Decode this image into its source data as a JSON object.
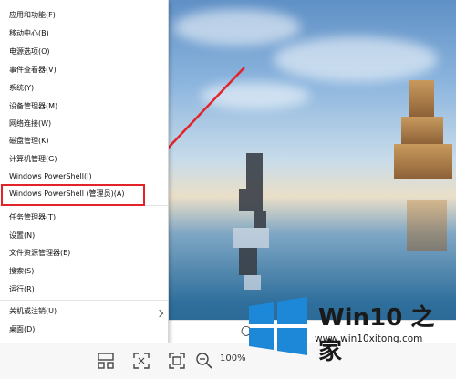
{
  "menu": {
    "items": [
      {
        "label": "应用和功能(F)"
      },
      {
        "label": "移动中心(B)"
      },
      {
        "label": "电源选项(O)"
      },
      {
        "label": "事件查看器(V)"
      },
      {
        "label": "系统(Y)"
      },
      {
        "label": "设备管理器(M)"
      },
      {
        "label": "网络连接(W)"
      },
      {
        "label": "磁盘管理(K)"
      },
      {
        "label": "计算机管理(G)"
      },
      {
        "label": "Windows PowerShell(I)"
      },
      {
        "label": "Windows PowerShell (管理员)(A)"
      },
      {
        "label": "任务管理器(T)"
      },
      {
        "label": "设置(N)"
      },
      {
        "label": "文件资源管理器(E)"
      },
      {
        "label": "搜索(S)"
      },
      {
        "label": "运行(R)"
      },
      {
        "label": "关机或注销(U)"
      },
      {
        "label": "桌面(D)"
      }
    ],
    "highlighted_item": "Windows PowerShell (管理员)(A)"
  },
  "toolbar": {
    "zoom_label": "100%"
  },
  "watermark": {
    "title": "Win10 之家",
    "url": "www.win10xitong.com"
  },
  "colors": {
    "highlight": "#e2242a",
    "arrow": "#e2242a",
    "windows_blue": "#1e88d8"
  },
  "icons": [
    "thumbnail-view-icon",
    "fullscreen-icon",
    "fit-window-icon",
    "zoom-out-icon",
    "chevron-right-icon",
    "windows-logo-icon"
  ]
}
